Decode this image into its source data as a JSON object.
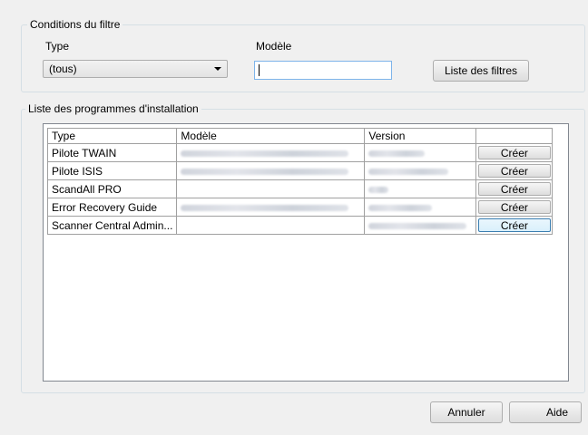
{
  "filter": {
    "group_title": "Conditions du filtre",
    "type_label": "Type",
    "type_selected": "(tous)",
    "model_label": "Modèle",
    "model_value": "",
    "filter_list_button": "Liste des filtres"
  },
  "installers": {
    "group_title": "Liste des programmes d'installation",
    "columns": [
      "Type",
      "Modèle",
      "Version",
      ""
    ],
    "rows": [
      {
        "type": "Pilote TWAIN",
        "action": "Créer"
      },
      {
        "type": "Pilote ISIS",
        "action": "Créer"
      },
      {
        "type": "ScandAll PRO",
        "action": "Créer"
      },
      {
        "type": "Error Recovery Guide",
        "action": "Créer"
      },
      {
        "type": "Scanner Central Admin...",
        "action": "Créer"
      }
    ]
  },
  "footer": {
    "cancel_button": "Annuler",
    "help_button": "Aide"
  }
}
